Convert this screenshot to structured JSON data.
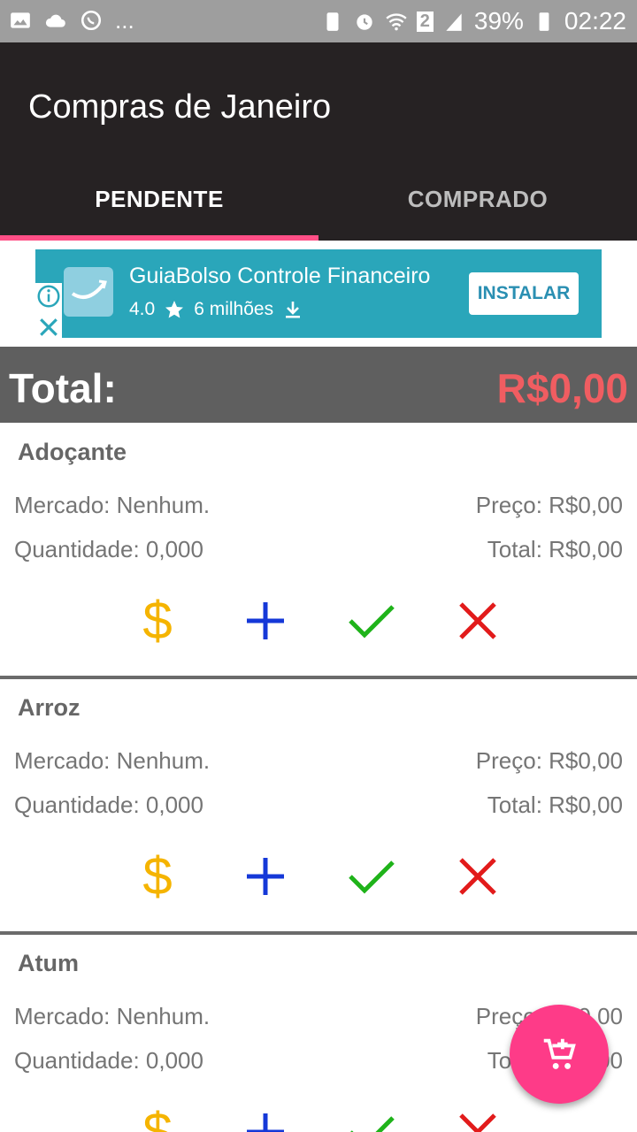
{
  "status_bar": {
    "battery": "39%",
    "time": "02:22",
    "sim_badge": "2",
    "left_icons": [
      "gallery-icon",
      "cloud-icon",
      "whatsapp-icon"
    ],
    "more_indicator": "..."
  },
  "app_bar": {
    "title": "Compras de Janeiro",
    "tabs": [
      {
        "label": "PENDENTE",
        "selected": true
      },
      {
        "label": "COMPRADO",
        "selected": false
      }
    ]
  },
  "ad": {
    "title": "GuiaBolso Controle Financeiro",
    "rating": "4.0",
    "downloads": "6 milhões",
    "button": "INSTALAR"
  },
  "summary": {
    "label": "Total:",
    "value": "R$0,00"
  },
  "items": [
    {
      "name": "Adoçante",
      "mercado": "Mercado: Nenhum.",
      "preco": "Preço: R$0,00",
      "quantidade": "Quantidade: 0,000",
      "total": "Total: R$0,00"
    },
    {
      "name": "Arroz",
      "mercado": "Mercado: Nenhum.",
      "preco": "Preço: R$0,00",
      "quantidade": "Quantidade: 0,000",
      "total": "Total: R$0,00"
    },
    {
      "name": "Atum",
      "mercado": "Mercado: Nenhum.",
      "preco": "Preço: R$0,00",
      "quantidade": "Quantidade: 0,000",
      "total": "Total: R$0,00"
    }
  ],
  "actions": {
    "price_symbol": "$",
    "colors": {
      "price": "#f5b400",
      "add": "#1538d8",
      "check": "#1fb31a",
      "remove": "#e21b1b"
    }
  },
  "colors": {
    "accent": "#ff4f86",
    "fab": "#fe3b88",
    "total_value": "#f05d61",
    "app_bar": "#262223"
  }
}
